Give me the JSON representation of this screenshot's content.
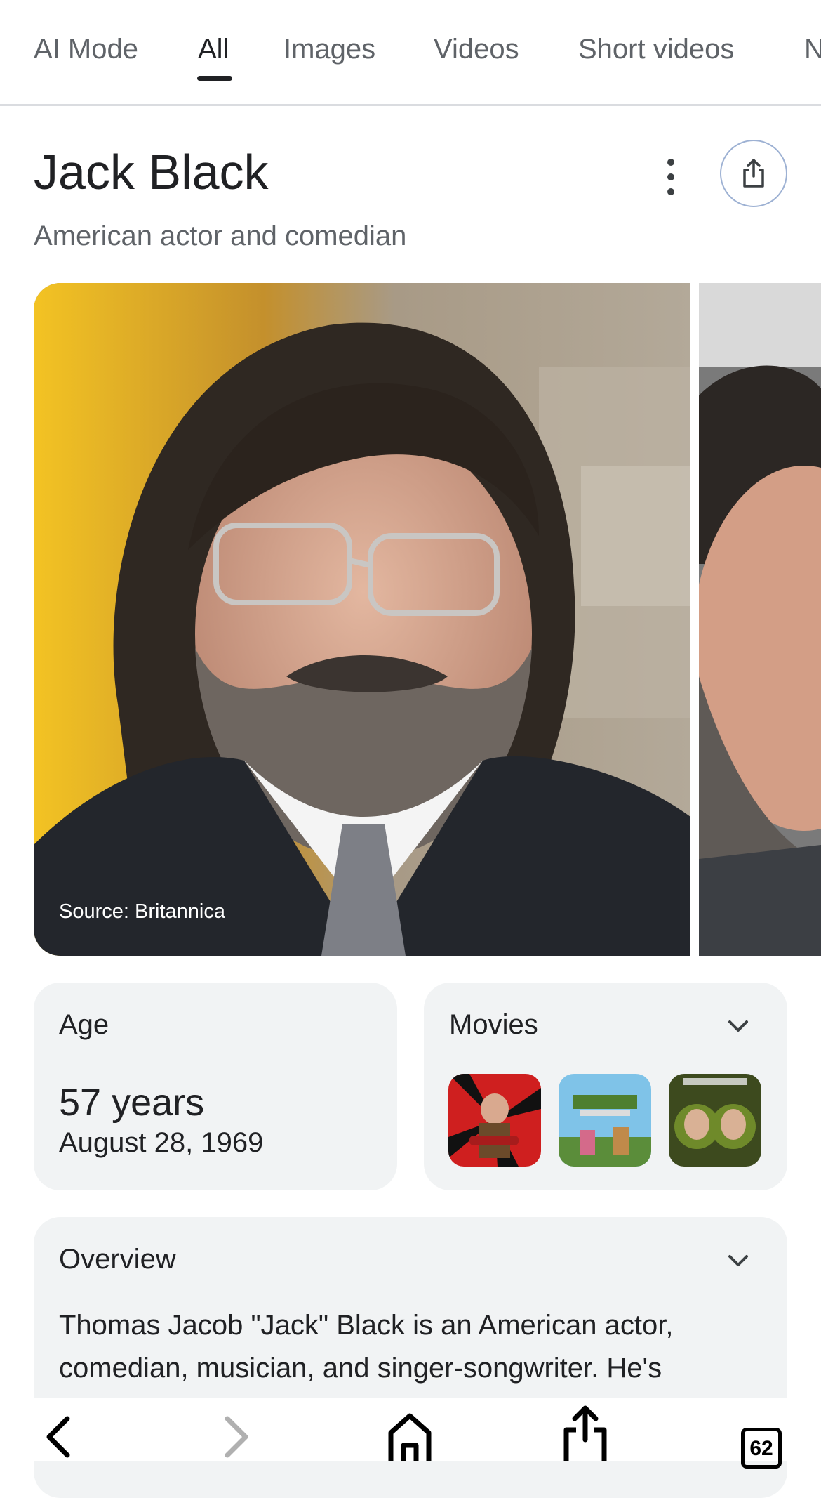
{
  "tabs": [
    {
      "label": "AI Mode",
      "active": false
    },
    {
      "label": "All",
      "active": true
    },
    {
      "label": "Images",
      "active": false
    },
    {
      "label": "Videos",
      "active": false
    },
    {
      "label": "Short videos",
      "active": false
    },
    {
      "label": "N",
      "active": false
    }
  ],
  "entity": {
    "title": "Jack Black",
    "subtitle": "American actor and comedian"
  },
  "images": {
    "source_label": "Source: Britannica"
  },
  "age_card": {
    "label": "Age",
    "value": "57 years",
    "birthdate": "August 28, 1969"
  },
  "movies_card": {
    "label": "Movies",
    "thumbnails": [
      "movie-poster-1",
      "movie-poster-2",
      "movie-poster-3"
    ]
  },
  "overview_card": {
    "label": "Overview",
    "text": "Thomas Jacob \"Jack\" Black is an American actor, comedian, musician, and singer-songwriter. He's"
  },
  "bottom_bar": {
    "tabs_count": "62"
  },
  "colors": {
    "accent_ring": "#9db1d3",
    "card_bg": "#f1f3f4",
    "text_primary": "#202124",
    "text_secondary": "#5f6368"
  }
}
